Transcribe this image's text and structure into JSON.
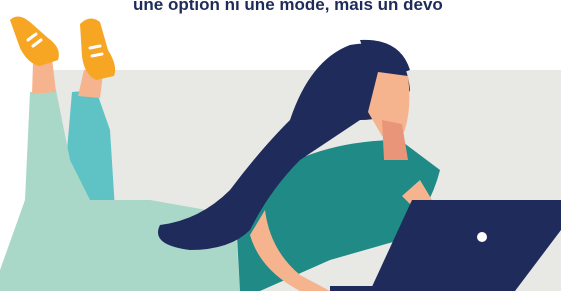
{
  "caption": {
    "text": "une option ni une mode, mais un devo"
  },
  "illustration": {
    "subject": "woman-lying-with-laptop",
    "colors": {
      "backdrop": "#e8e8e5",
      "hair": "#1f2b5a",
      "skin": "#f6b48e",
      "skin_shadow": "#e8957a",
      "shirt": "#1f8a86",
      "shirt_dark": "#17706d",
      "pants": "#aad8c8",
      "pants_shadow": "#5fc3c6",
      "shoes": "#f6a623",
      "shoe_stripe": "#ffffff",
      "laptop": "#1f2b5a",
      "laptop_dot": "#ffffff",
      "caption": "#1f2b5a"
    }
  }
}
